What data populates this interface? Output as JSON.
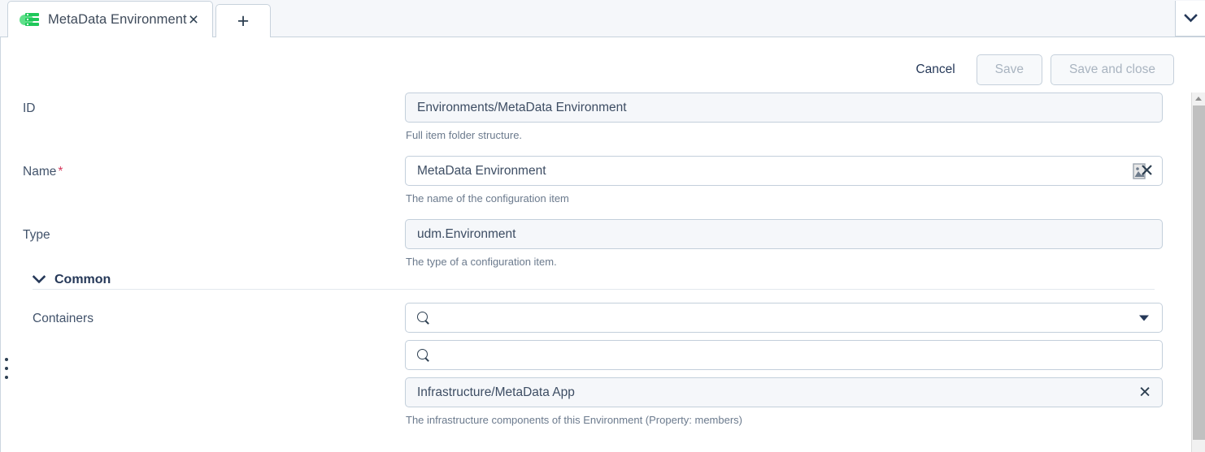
{
  "tabs": {
    "active": {
      "title": "MetaData Environment",
      "icon": "environment-server-icon",
      "close_label": "×"
    },
    "new_tab_label": "+",
    "overflow_icon": "chevron-down-icon"
  },
  "toolbar": {
    "cancel_label": "Cancel",
    "save_label": "Save",
    "save_and_close_label": "Save and close"
  },
  "form": {
    "fields": [
      {
        "label": "ID",
        "required": false,
        "value": "Environments/MetaData Environment",
        "hint": "Full item folder structure.",
        "readonly": true
      },
      {
        "label": "Name",
        "required": true,
        "value": "MetaData Environment",
        "hint": "The name of the configuration item",
        "readonly": false
      },
      {
        "label": "Type",
        "required": false,
        "value": "udm.Environment",
        "hint": "The type of a configuration item.",
        "readonly": true
      }
    ],
    "section": {
      "title": "Common",
      "expanded": true,
      "chevron_icon": "chevron-down-icon"
    },
    "containers": {
      "label": "Containers",
      "search_placeholder": "",
      "search_value_1": "",
      "search_value_2": "",
      "selected_value": "Infrastructure/MetaData App",
      "clear_label": "✕",
      "hint": "The infrastructure components of this Environment (Property: members)"
    }
  },
  "colors": {
    "accent": "#253858",
    "required": "#d63a5e",
    "icon_green": "#1fc75a",
    "border": "#c3cfdb",
    "readonly_bg": "#f5f7fa",
    "hint_text": "#6b7a8d"
  }
}
